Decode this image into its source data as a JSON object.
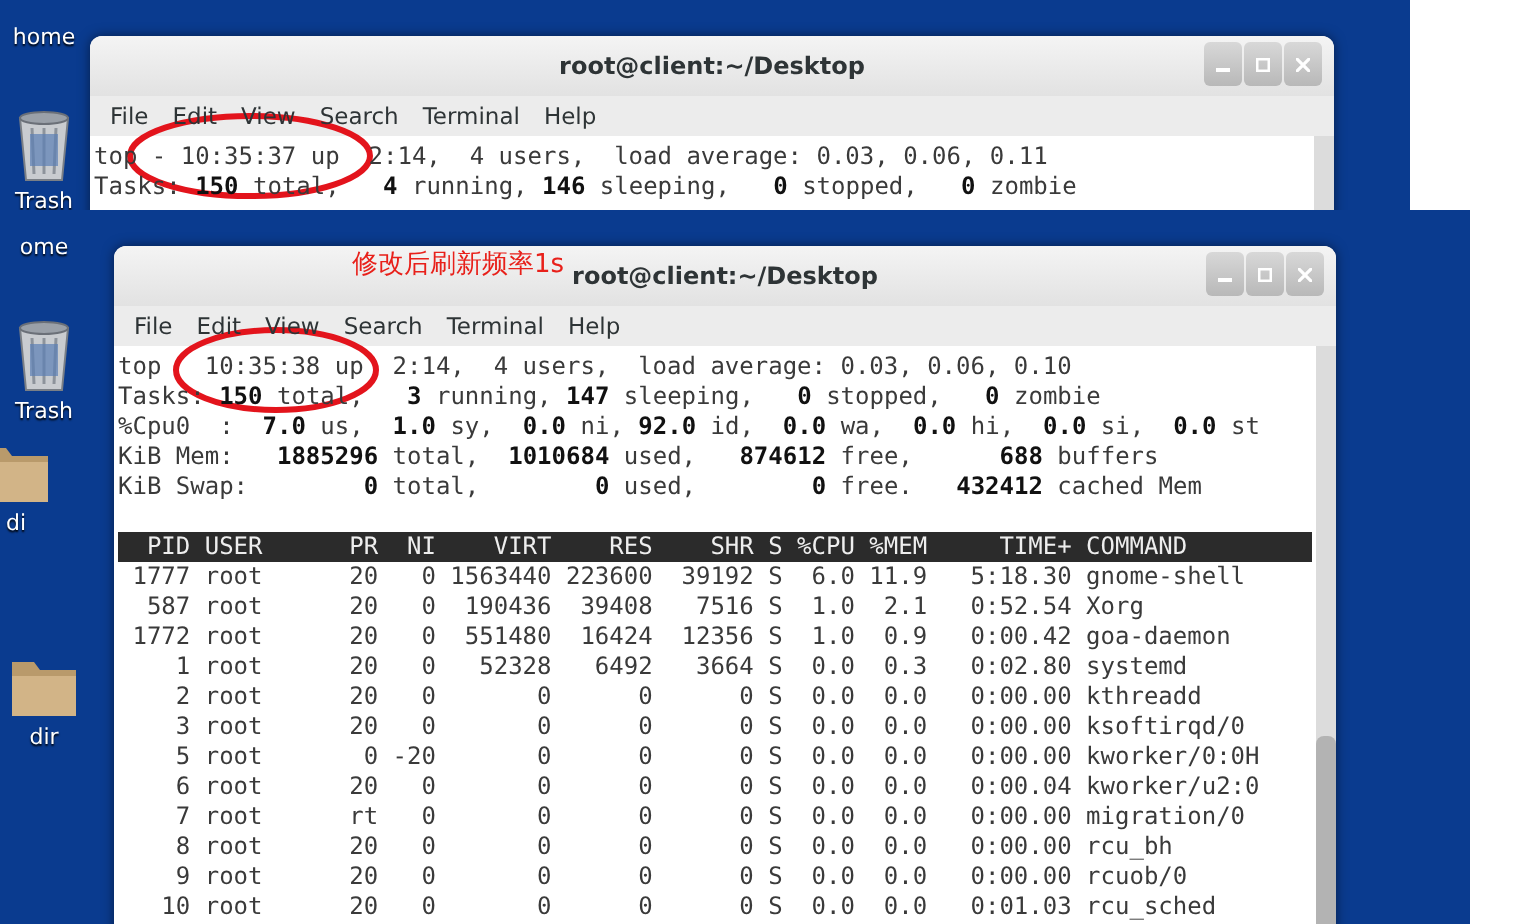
{
  "panels": [
    {
      "desktop_icons": [
        {
          "kind": "cut",
          "label": "home"
        },
        {
          "kind": "trash",
          "label": "Trash"
        }
      ],
      "window": {
        "title": "root@client:~/Desktop",
        "menu": [
          "File",
          "Edit",
          "View",
          "Search",
          "Terminal",
          "Help"
        ],
        "lines": [
          "top - 10:35:37 up  2:14,  4 users,  load average: 0.03, 0.06, 0.11",
          "Tasks: **150** total,   **4** running, **146** sleeping,   **0** stopped,   **0** zombie"
        ]
      }
    },
    {
      "desktop_icons": [
        {
          "kind": "cut",
          "label": "ome"
        },
        {
          "kind": "trash",
          "label": "Trash"
        },
        {
          "kind": "folder",
          "label": "di"
        },
        {
          "kind": "folder",
          "label": "dir"
        }
      ],
      "annotation_note": "修改后刷新频率1s",
      "window": {
        "title": "root@client:~/Desktop",
        "menu": [
          "File",
          "Edit",
          "View",
          "Search",
          "Terminal",
          "Help"
        ],
        "lines": [
          "top   10:35:38 up  2:14,  4 users,  load average: 0.03, 0.06, 0.10",
          "Tasks: **150** total,   **3** running, **147** sleeping,   **0** stopped,   **0** zombie",
          "%Cpu0  :  **7.0** us,  **1.0** sy,  **0.0** ni, **92.0** id,  **0.0** wa,  **0.0** hi,  **0.0** si,  **0.0** st",
          "KiB Mem:   **1885296** total,  **1010684** used,   **874612** free,      **688** buffers",
          "KiB Swap:        **0** total,        **0** used,        **0** free.   **432412** cached Mem"
        ],
        "process_header": "  PID USER      PR  NI    VIRT    RES    SHR S %CPU %MEM     TIME+ COMMAND",
        "process_rows": [
          " 1777 root      20   0 1563440 223600  39192 S  6.0 11.9   5:18.30 gnome-shell",
          "  587 root      20   0  190436  39408   7516 S  1.0  2.1   0:52.54 Xorg",
          " 1772 root      20   0  551480  16424  12356 S  1.0  0.9   0:00.42 goa-daemon",
          "    1 root      20   0   52328   6492   3664 S  0.0  0.3   0:02.80 systemd",
          "    2 root      20   0       0      0      0 S  0.0  0.0   0:00.00 kthreadd",
          "    3 root      20   0       0      0      0 S  0.0  0.0   0:00.00 ksoftirqd/0",
          "    5 root       0 -20       0      0      0 S  0.0  0.0   0:00.00 kworker/0:0H",
          "    6 root      20   0       0      0      0 S  0.0  0.0   0:00.04 kworker/u2:0",
          "    7 root      rt   0       0      0      0 S  0.0  0.0   0:00.00 migration/0",
          "    8 root      20   0       0      0      0 S  0.0  0.0   0:00.00 rcu_bh",
          "    9 root      20   0       0      0      0 S  0.0  0.0   0:00.00 rcuob/0",
          "   10 root      20   0       0      0      0 S  0.0  0.0   0:01.03 rcu_sched"
        ]
      }
    }
  ]
}
